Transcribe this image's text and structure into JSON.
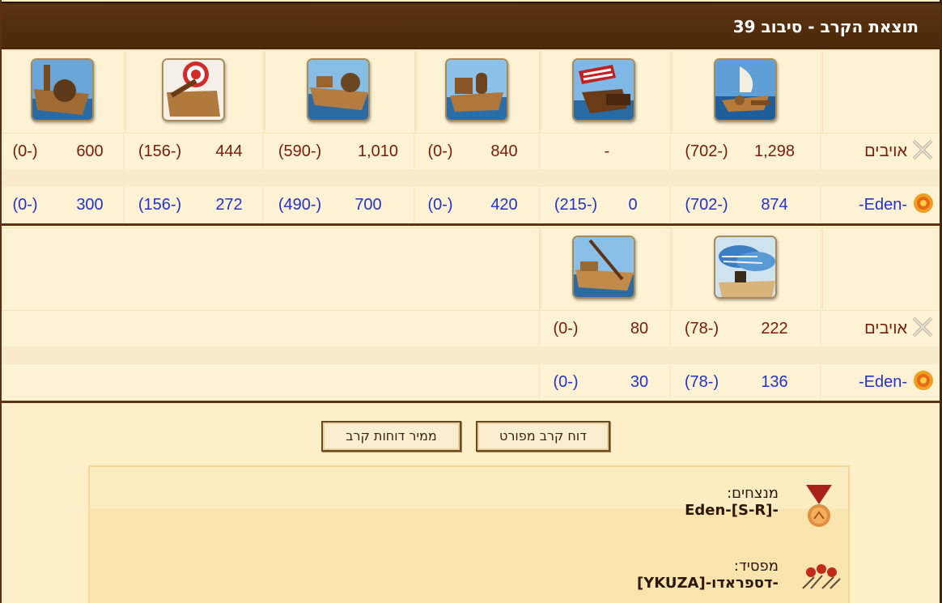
{
  "title": "תוצאת הקרב - סיבוב 39",
  "rows": {
    "enemy_label": "אויבים",
    "own_label": "-Eden-"
  },
  "table1": {
    "units": [
      "steam-ram",
      "fire-ship",
      "ballista-ship",
      "paddle-ship",
      "catapult-ship",
      "mortar-ship"
    ],
    "enemy": [
      {
        "a": "1,298",
        "b": "(702-)"
      },
      {
        "a": "-",
        "b": ""
      },
      {
        "a": "840",
        "b": "(0-)"
      },
      {
        "a": "1,010",
        "b": "(590-)"
      },
      {
        "a": "444",
        "b": "(156-)"
      },
      {
        "a": "600",
        "b": "(0-)"
      }
    ],
    "own": [
      {
        "a": "874",
        "b": "(702-)"
      },
      {
        "a": "0",
        "b": "(215-)"
      },
      {
        "a": "420",
        "b": "(0-)"
      },
      {
        "a": "700",
        "b": "(490-)"
      },
      {
        "a": "272",
        "b": "(156-)"
      },
      {
        "a": "300",
        "b": "(0-)"
      }
    ]
  },
  "table2": {
    "units": [
      "balloon-carrier",
      "tender-ship"
    ],
    "enemy": [
      {
        "a": "222",
        "b": "(78-)"
      },
      {
        "a": "80",
        "b": "(0-)"
      }
    ],
    "own": [
      {
        "a": "136",
        "b": "(78-)"
      },
      {
        "a": "30",
        "b": "(0-)"
      }
    ]
  },
  "buttons": {
    "detailed_report": "דוח קרב מפורט",
    "report_converter": "ממיר דוחות קרב"
  },
  "result": {
    "winners_label": "מנצחים:",
    "winners_value": "Eden-[S-R]-",
    "loser_label": "מפסיד:",
    "loser_value": "-דספראדו-[YKUZA]"
  },
  "colors": {
    "enemy": "#7a1a10",
    "own": "#2333c9",
    "title_bg": "#4b2808"
  }
}
